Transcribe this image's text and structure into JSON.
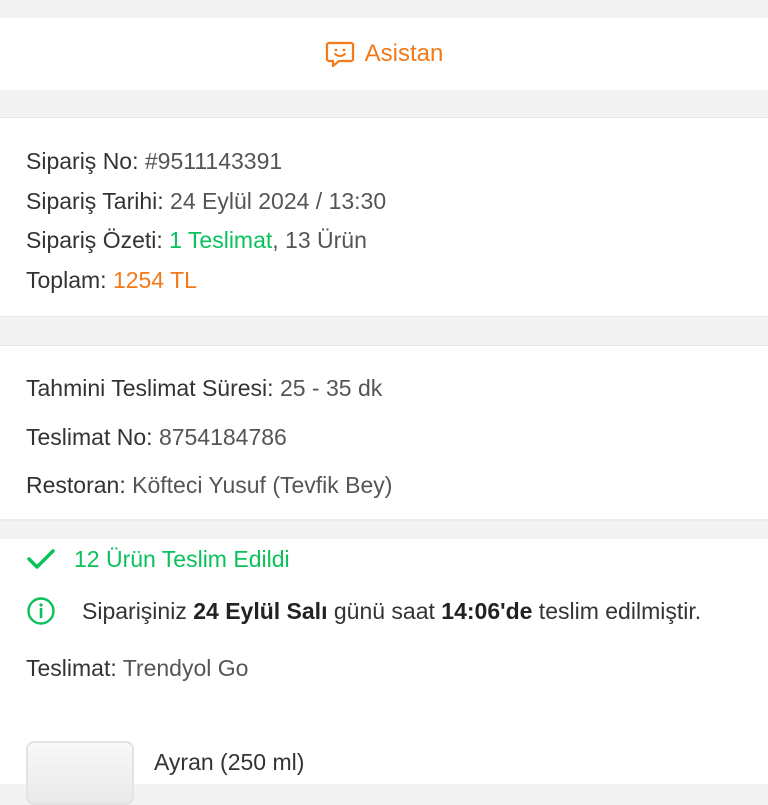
{
  "assistant": {
    "label": "Asistan",
    "icon": "chat-smile-icon"
  },
  "order": {
    "no_label": "Sipariş No:",
    "no_value": "#9511143391",
    "date_label": "Sipariş Tarihi:",
    "date_value": "24 Eylül 2024 / 13:30",
    "summary_label": "Sipariş Özeti:",
    "summary_delivery": "1 Teslimat",
    "summary_sep": ",",
    "summary_items": " 13 Ürün",
    "total_label": "Toplam:",
    "total_value": "1254 TL"
  },
  "delivery": {
    "eta_label": "Tahmini Teslimat Süresi:",
    "eta_value": "25 - 35 dk",
    "no_label": "Teslimat No:",
    "no_value": "8754184786",
    "restaurant_label": "Restoran:",
    "restaurant_value": "Köfteci Yusuf (Tevfik Bey)"
  },
  "status": {
    "delivered_text": "12 Ürün Teslim Edildi",
    "info_pre": "Siparişiniz ",
    "info_date": "24 Eylül Salı",
    "info_mid": " günü saat ",
    "info_time": "14:06'de",
    "info_post": " teslim edilmiştir.",
    "courier_label": "Teslimat:",
    "courier_value": "Trendyol Go"
  },
  "products": [
    {
      "name": "Ayran (250 ml)"
    }
  ],
  "colors": {
    "accent": "#f27a1a",
    "success": "#0bc15c"
  }
}
